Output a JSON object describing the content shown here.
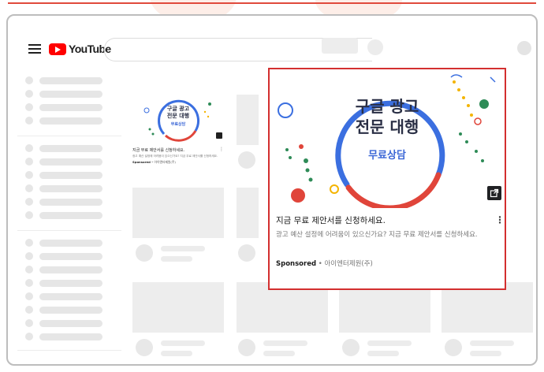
{
  "app": {
    "logo_text": "YouTube",
    "brand_color": "#ff0000",
    "highlight_color": "#d32f2f"
  },
  "icons": [
    "menu-icon",
    "youtube-logo",
    "external-link-icon",
    "more-vert-icon"
  ],
  "ad": {
    "headline_line1": "구글 광고",
    "headline_line2": "전문 대행",
    "cta": "무료상담",
    "title": "지금 무료 제안서를 신청하세요.",
    "description": "광고 예산 설정에 어려움이 있으신가요? 지금 무료 제안서를 신청하세요.",
    "sponsored": "Sponsored",
    "separator": " • ",
    "advertiser": "아이엔터제원(주)",
    "more": "⋮"
  }
}
